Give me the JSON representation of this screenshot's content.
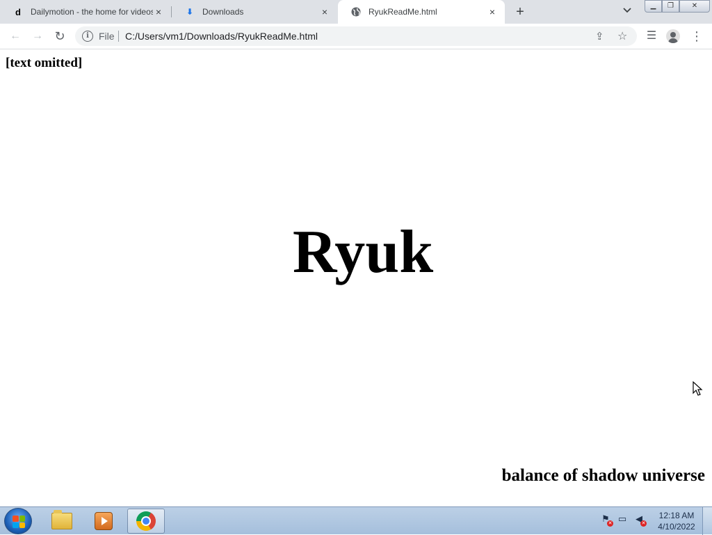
{
  "browser": {
    "tabs": [
      {
        "favicon": "d",
        "title": "Dailymotion - the home for videos",
        "active": false
      },
      {
        "favicon": "download-icon",
        "title": "Downloads",
        "active": false
      },
      {
        "favicon": "globe-icon",
        "title": "RyukReadMe.html",
        "active": true
      }
    ],
    "new_tab_symbol": "+",
    "tab_search_symbol": "⌄",
    "window_controls": {
      "minimize": "▁",
      "maximize": "❐",
      "close": "✕"
    },
    "toolbar": {
      "back_symbol": "←",
      "forward_symbol": "→",
      "reload_symbol": "↻",
      "info_symbol": "i",
      "scheme_label": "File",
      "url": "C:/Users/vm1/Downloads/RyukReadMe.html",
      "share_symbol": "⇪",
      "bookmark_symbol": "☆",
      "reading_list_symbol": "☰",
      "menu_symbol": "⋮"
    }
  },
  "page": {
    "top_text": "[text omitted]",
    "title": "Ryuk",
    "bottom_text": "balance of shadow universe"
  },
  "taskbar": {
    "apps": [
      "windows-explorer-icon",
      "media-player-icon",
      "chrome-icon"
    ],
    "active_app": "chrome-icon",
    "clock_time": "12:18 AM",
    "clock_date": "4/10/2022"
  },
  "colors": {
    "tabstrip_bg": "#dee1e6",
    "omnibox_bg": "#f1f3f4",
    "taskbar_bg": "#a5bfdc"
  }
}
